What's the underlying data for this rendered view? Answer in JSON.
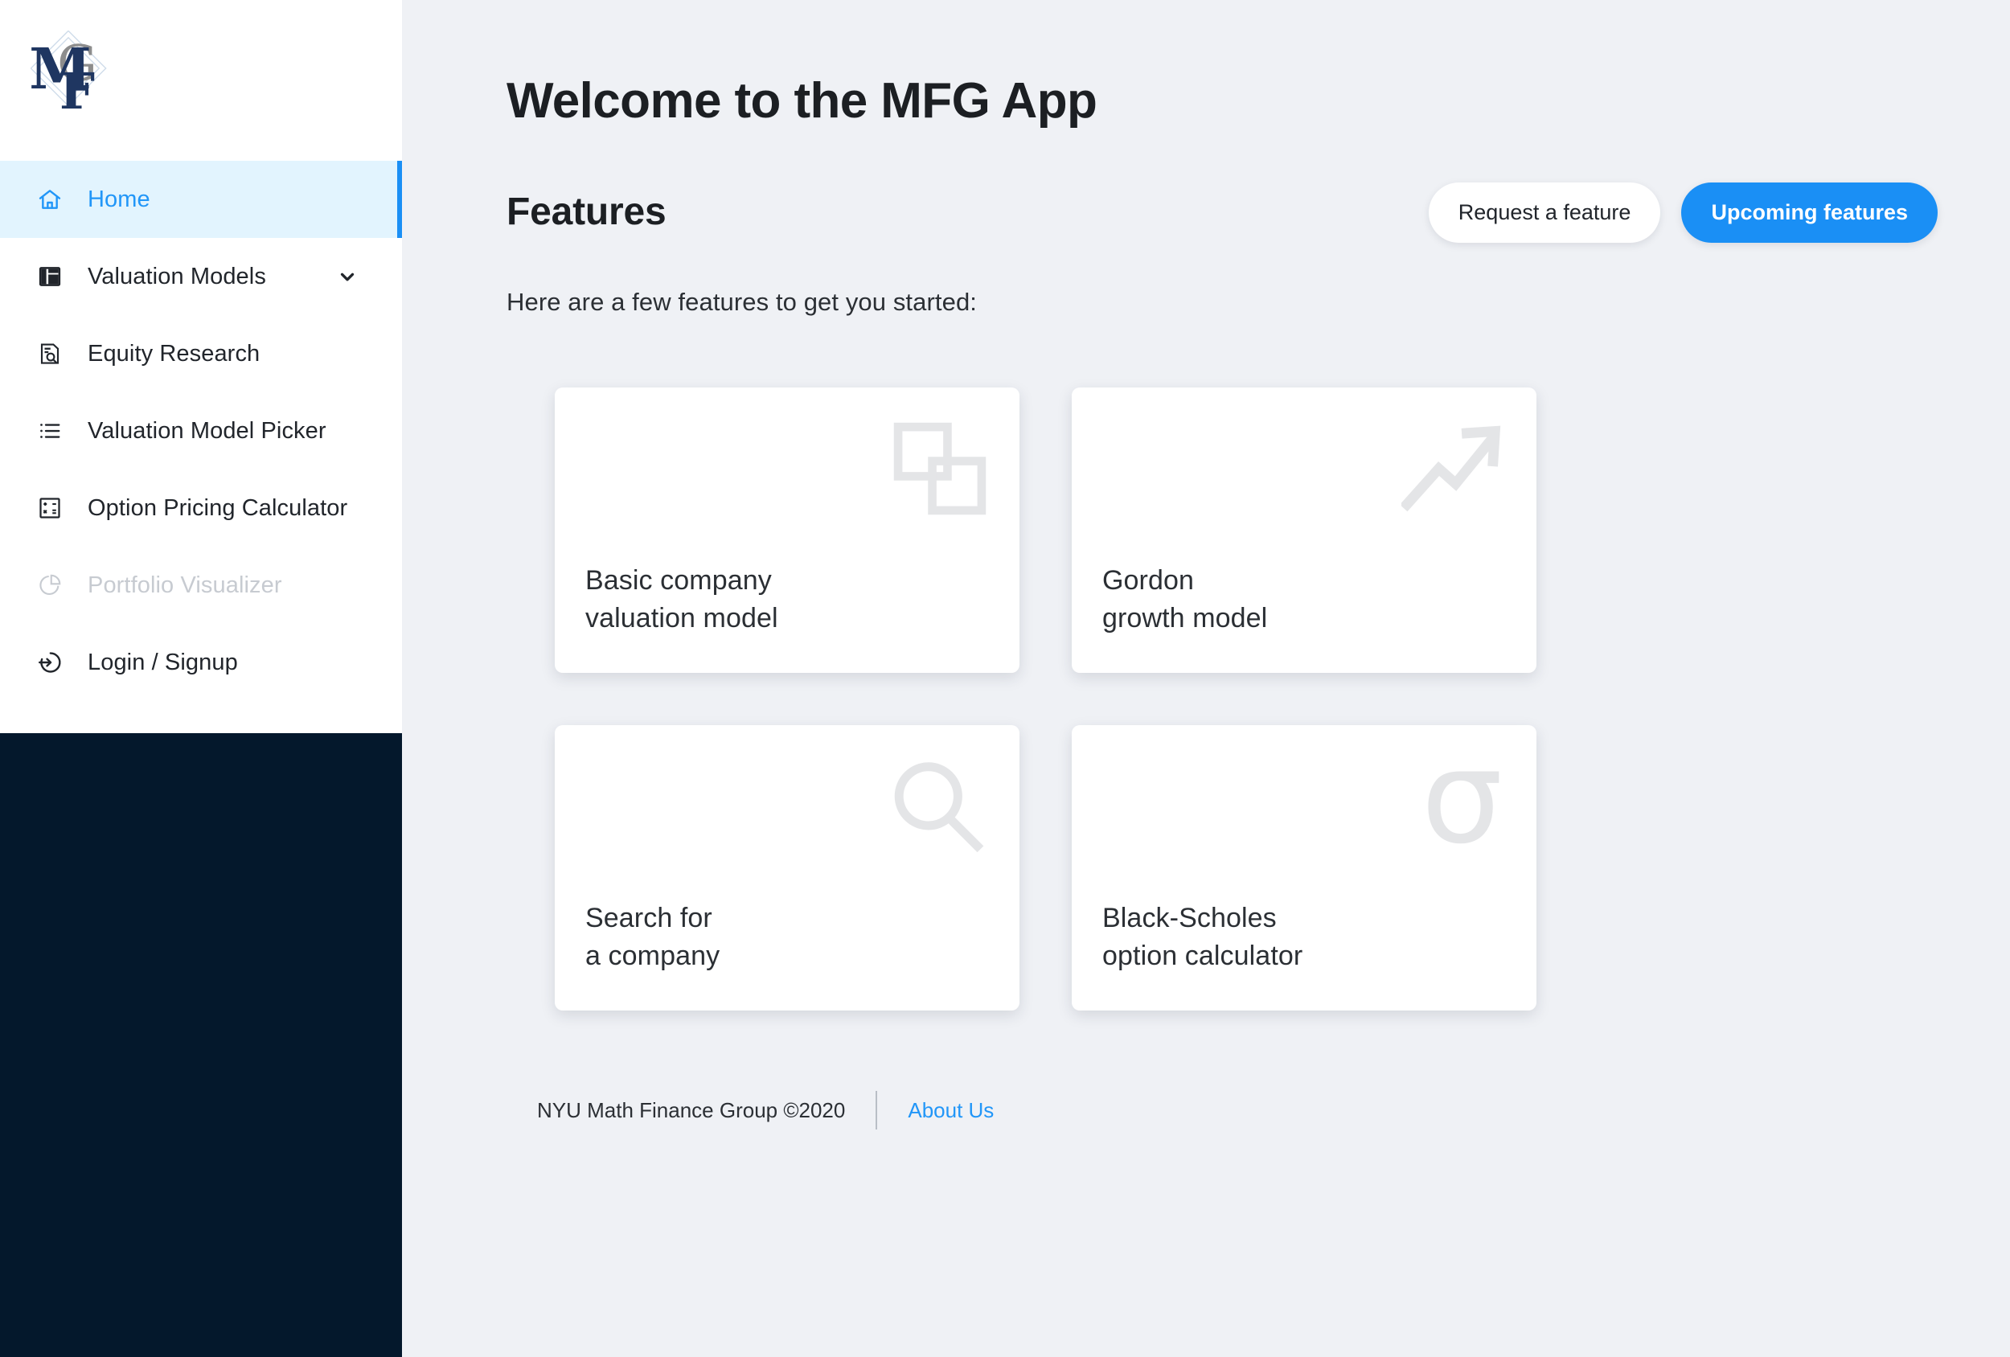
{
  "brand": {
    "logo_text": "MFG",
    "logo_letters": [
      "M",
      "F",
      "G"
    ]
  },
  "colors": {
    "accent_blue": "#1a8ff5",
    "link_blue": "#2196f8",
    "active_bg": "#e2f4fe",
    "page_bg": "#eff1f5",
    "sidebar_dark": "#04182c",
    "card_icon_gray": "#e4e5e7",
    "disabled_text": "#c7cbd1",
    "logo_navy": "#1f3661"
  },
  "sidebar": {
    "items": [
      {
        "label": "Home",
        "icon": "home-icon",
        "active": true,
        "disabled": false,
        "chevron": false
      },
      {
        "label": "Valuation Models",
        "icon": "layout-panel-icon",
        "active": false,
        "disabled": false,
        "chevron": true
      },
      {
        "label": "Equity Research",
        "icon": "document-search-icon",
        "active": false,
        "disabled": false,
        "chevron": false
      },
      {
        "label": "Valuation Model Picker",
        "icon": "list-icon",
        "active": false,
        "disabled": false,
        "chevron": false
      },
      {
        "label": "Option Pricing Calculator",
        "icon": "calculator-icon",
        "active": false,
        "disabled": false,
        "chevron": false
      },
      {
        "label": "Portfolio Visualizer",
        "icon": "pie-chart-icon",
        "active": false,
        "disabled": true,
        "chevron": false
      },
      {
        "label": "Login / Signup",
        "icon": "login-icon",
        "active": false,
        "disabled": false,
        "chevron": false
      }
    ]
  },
  "main": {
    "page_title": "Welcome to the MFG App",
    "section_title": "Features",
    "lead_text": "Here are a few features to get you started:",
    "buttons": {
      "request_feature": "Request a feature",
      "upcoming_features": "Upcoming features"
    },
    "cards": [
      {
        "line1": "Basic company",
        "line2": "valuation model",
        "icon": "overlapping-squares-icon"
      },
      {
        "line1": "Gordon",
        "line2": "growth model",
        "icon": "trending-up-arrow-icon"
      },
      {
        "line1": "Search for",
        "line2": "a company",
        "icon": "magnifier-icon"
      },
      {
        "line1": "Black-Scholes",
        "line2": "option calculator",
        "icon": "sigma-icon",
        "glyph": "σ"
      }
    ]
  },
  "footer": {
    "copyright": "NYU Math Finance Group ©2020",
    "about_link": "About Us"
  }
}
